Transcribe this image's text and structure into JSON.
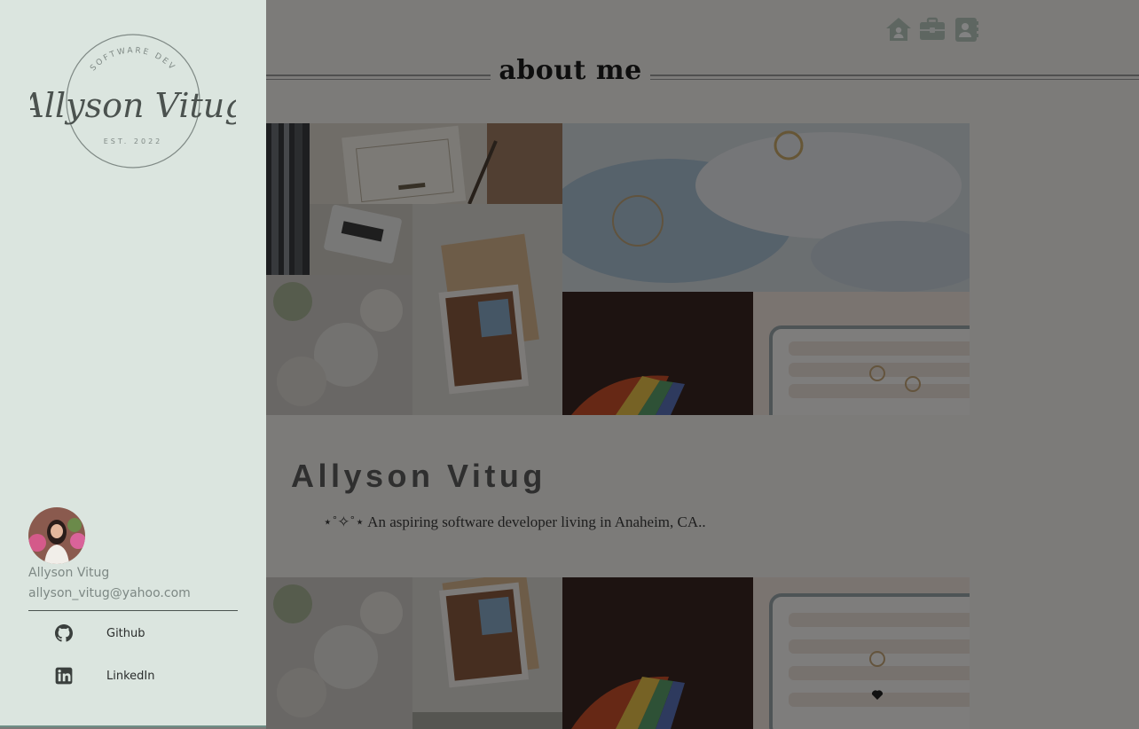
{
  "header": {
    "title": "about me",
    "nav_icons": [
      "home-icon",
      "briefcase-icon",
      "contact-card-icon"
    ]
  },
  "profile": {
    "heading": "Allyson Vitug",
    "bio": "⋆˚✧˚⋆ An aspiring software developer living in Anaheim, CA.."
  },
  "sidebar": {
    "logo": {
      "script_text": "Allyson Vitug",
      "top_arc_text": "SOFTWARE DEV",
      "bottom_text": "EST. 2022"
    },
    "user": {
      "name": "Allyson Vitug",
      "email": "allyson_vitug@yahoo.com"
    },
    "links": [
      {
        "label": "Github",
        "icon": "github-icon"
      },
      {
        "label": "LinkedIn",
        "icon": "linkedin-icon"
      }
    ]
  },
  "colors": {
    "sidebar_bg": "#dbe5df",
    "page_bg": "#f4f2ee",
    "overlay": "rgba(0,0,0,0.49)",
    "text_dark": "#2a2d2c",
    "text_muted": "#7d8884"
  }
}
